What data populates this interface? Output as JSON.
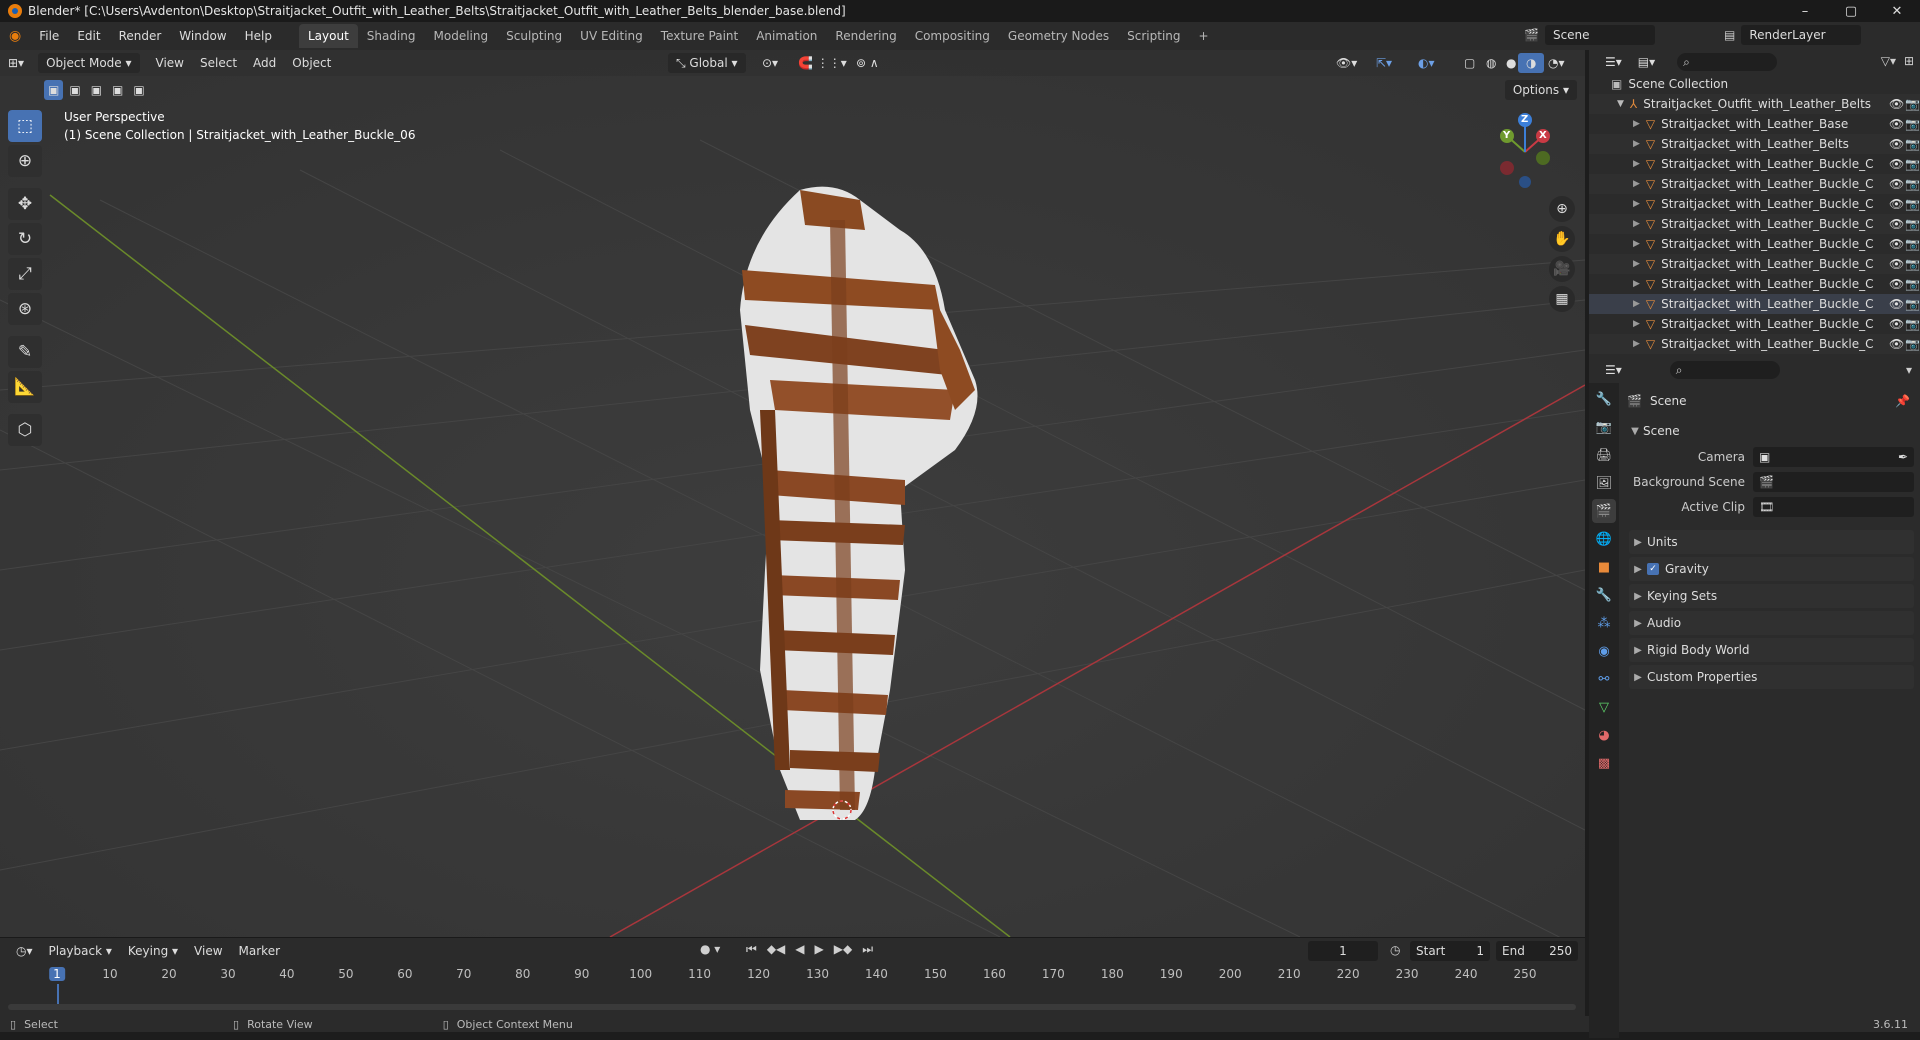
{
  "window": {
    "title": "Blender* [C:\\Users\\Avdenton\\Desktop\\Straitjacket_Outfit_with_Leather_Belts\\Straitjacket_Outfit_with_Leather_Belts_blender_base.blend]",
    "controls": [
      "–",
      "▢",
      "✕"
    ]
  },
  "menubar": {
    "menus": [
      "File",
      "Edit",
      "Render",
      "Window",
      "Help"
    ],
    "workspaces": [
      "Layout",
      "Shading",
      "Modeling",
      "Sculpting",
      "UV Editing",
      "Texture Paint",
      "Animation",
      "Rendering",
      "Compositing",
      "Geometry Nodes",
      "Scripting"
    ],
    "active_workspace": "Layout",
    "add_tab": "+",
    "scene": "Scene",
    "view_layer": "RenderLayer"
  },
  "viewport": {
    "mode": "Object Mode",
    "menus": [
      "View",
      "Select",
      "Add",
      "Object"
    ],
    "orientation": "Global",
    "options": "Options",
    "info_line1": "User Perspective",
    "info_line2": "(1) Scene Collection | Straitjacket_with_Leather_Buckle_06",
    "gizmo_axes": [
      "X",
      "Y",
      "Z"
    ]
  },
  "outliner": {
    "root": "Scene Collection",
    "collection": "Straitjacket_Outfit_with_Leather_Belts",
    "objects": [
      "Straitjacket_with_Leather_Base",
      "Straitjacket_with_Leather_Belts",
      "Straitjacket_with_Leather_Buckle_C",
      "Straitjacket_with_Leather_Buckle_C",
      "Straitjacket_with_Leather_Buckle_C",
      "Straitjacket_with_Leather_Buckle_C",
      "Straitjacket_with_Leather_Buckle_C",
      "Straitjacket_with_Leather_Buckle_C",
      "Straitjacket_with_Leather_Buckle_C",
      "Straitjacket_with_Leather_Buckle_C",
      "Straitjacket_with_Leather_Buckle_C",
      "Straitjacket_with_Leather_Buckle_C"
    ]
  },
  "properties": {
    "context": "Scene",
    "panel": "Scene",
    "fields": [
      {
        "label": "Camera",
        "value": ""
      },
      {
        "label": "Background Scene",
        "value": ""
      },
      {
        "label": "Active Clip",
        "value": ""
      }
    ],
    "subpanels": [
      "Units",
      "Gravity",
      "Keying Sets",
      "Audio",
      "Rigid Body World",
      "Custom Properties"
    ],
    "gravity_checked": true
  },
  "timeline": {
    "menus": [
      "Playback",
      "Keying",
      "View",
      "Marker"
    ],
    "current_frame": "1",
    "start_label": "Start",
    "start": "1",
    "end_label": "End",
    "end": "250",
    "ruler": [
      "1",
      "10",
      "20",
      "30",
      "40",
      "50",
      "60",
      "70",
      "80",
      "90",
      "100",
      "110",
      "120",
      "130",
      "140",
      "150",
      "160",
      "170",
      "180",
      "190",
      "200",
      "210",
      "220",
      "230",
      "240",
      "250"
    ]
  },
  "statusbar": {
    "select": "Select",
    "rotate": "Rotate View",
    "context_menu": "Object Context Menu",
    "version": "3.6.11"
  }
}
